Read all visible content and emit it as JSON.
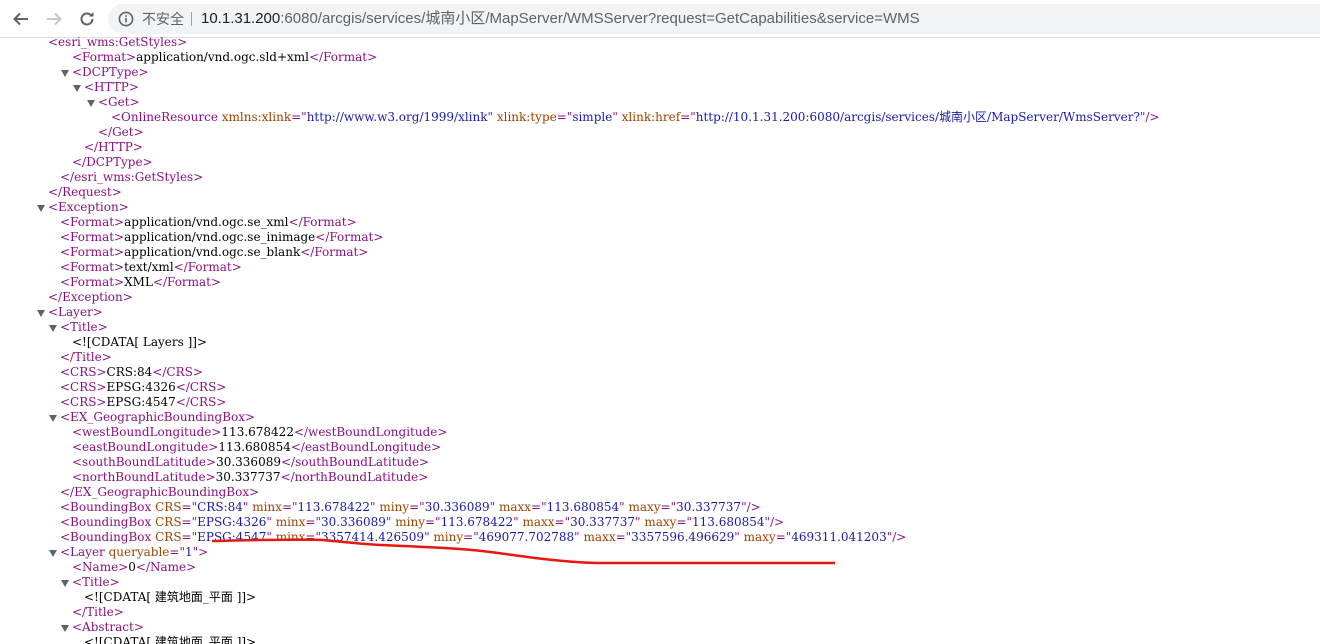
{
  "browser": {
    "security_label": "不安全",
    "url_host": "10.1.31.200",
    "url_rest": ":6080/arcgis/services/城南小区/MapServer/WMSServer?request=GetCapabilities&service=WMS"
  },
  "xml": {
    "lines": [
      {
        "indent": 48,
        "toggle": false,
        "segs": [
          {
            "c": "t",
            "v": "<esri_wms:GetStyles>"
          }
        ]
      },
      {
        "indent": 72,
        "toggle": false,
        "segs": [
          {
            "c": "t",
            "v": "<Format>"
          },
          {
            "c": "",
            "v": "application/vnd.ogc.sld+xml"
          },
          {
            "c": "t",
            "v": "</Format>"
          }
        ]
      },
      {
        "indent": 72,
        "toggle": true,
        "segs": [
          {
            "c": "t",
            "v": "<DCPType>"
          }
        ]
      },
      {
        "indent": 84,
        "toggle": true,
        "segs": [
          {
            "c": "t",
            "v": "<HTTP>"
          }
        ]
      },
      {
        "indent": 98,
        "toggle": true,
        "segs": [
          {
            "c": "t",
            "v": "<Get>"
          }
        ]
      },
      {
        "indent": 111,
        "toggle": false,
        "segs": [
          {
            "c": "t",
            "v": "<OnlineResource "
          },
          {
            "c": "an",
            "v": "xmlns:xlink"
          },
          {
            "c": "t",
            "v": "=\""
          },
          {
            "c": "av",
            "v": "http://www.w3.org/1999/xlink"
          },
          {
            "c": "t",
            "v": "\" "
          },
          {
            "c": "an",
            "v": "xlink:type"
          },
          {
            "c": "t",
            "v": "=\""
          },
          {
            "c": "av",
            "v": "simple"
          },
          {
            "c": "t",
            "v": "\" "
          },
          {
            "c": "an",
            "v": "xlink:href"
          },
          {
            "c": "t",
            "v": "=\""
          },
          {
            "c": "av",
            "v": "http://10.1.31.200:6080/arcgis/services/城南小区/MapServer/WmsServer?"
          },
          {
            "c": "t",
            "v": "\"/>"
          }
        ]
      },
      {
        "indent": 98,
        "toggle": false,
        "segs": [
          {
            "c": "t",
            "v": "</Get>"
          }
        ]
      },
      {
        "indent": 84,
        "toggle": false,
        "segs": [
          {
            "c": "t",
            "v": "</HTTP>"
          }
        ]
      },
      {
        "indent": 72,
        "toggle": false,
        "segs": [
          {
            "c": "t",
            "v": "</DCPType>"
          }
        ]
      },
      {
        "indent": 60,
        "toggle": false,
        "segs": [
          {
            "c": "t",
            "v": "</esri_wms:GetStyles>"
          }
        ]
      },
      {
        "indent": 48,
        "toggle": false,
        "segs": [
          {
            "c": "t",
            "v": "</Request>"
          }
        ]
      },
      {
        "indent": 48,
        "toggle": true,
        "segs": [
          {
            "c": "t",
            "v": "<Exception>"
          }
        ]
      },
      {
        "indent": 60,
        "toggle": false,
        "segs": [
          {
            "c": "t",
            "v": "<Format>"
          },
          {
            "c": "",
            "v": "application/vnd.ogc.se_xml"
          },
          {
            "c": "t",
            "v": "</Format>"
          }
        ]
      },
      {
        "indent": 60,
        "toggle": false,
        "segs": [
          {
            "c": "t",
            "v": "<Format>"
          },
          {
            "c": "",
            "v": "application/vnd.ogc.se_inimage"
          },
          {
            "c": "t",
            "v": "</Format>"
          }
        ]
      },
      {
        "indent": 60,
        "toggle": false,
        "segs": [
          {
            "c": "t",
            "v": "<Format>"
          },
          {
            "c": "",
            "v": "application/vnd.ogc.se_blank"
          },
          {
            "c": "t",
            "v": "</Format>"
          }
        ]
      },
      {
        "indent": 60,
        "toggle": false,
        "segs": [
          {
            "c": "t",
            "v": "<Format>"
          },
          {
            "c": "",
            "v": "text/xml"
          },
          {
            "c": "t",
            "v": "</Format>"
          }
        ]
      },
      {
        "indent": 60,
        "toggle": false,
        "segs": [
          {
            "c": "t",
            "v": "<Format>"
          },
          {
            "c": "",
            "v": "XML"
          },
          {
            "c": "t",
            "v": "</Format>"
          }
        ]
      },
      {
        "indent": 48,
        "toggle": false,
        "segs": [
          {
            "c": "t",
            "v": "</Exception>"
          }
        ]
      },
      {
        "indent": 48,
        "toggle": true,
        "segs": [
          {
            "c": "t",
            "v": "<Layer>"
          }
        ]
      },
      {
        "indent": 60,
        "toggle": true,
        "segs": [
          {
            "c": "t",
            "v": "<Title>"
          }
        ]
      },
      {
        "indent": 72,
        "toggle": false,
        "segs": [
          {
            "c": "",
            "v": "<![CDATA[ Layers ]]>"
          }
        ]
      },
      {
        "indent": 60,
        "toggle": false,
        "segs": [
          {
            "c": "t",
            "v": "</Title>"
          }
        ]
      },
      {
        "indent": 60,
        "toggle": false,
        "segs": [
          {
            "c": "t",
            "v": "<CRS>"
          },
          {
            "c": "",
            "v": "CRS:84"
          },
          {
            "c": "t",
            "v": "</CRS>"
          }
        ]
      },
      {
        "indent": 60,
        "toggle": false,
        "segs": [
          {
            "c": "t",
            "v": "<CRS>"
          },
          {
            "c": "",
            "v": "EPSG:4326"
          },
          {
            "c": "t",
            "v": "</CRS>"
          }
        ]
      },
      {
        "indent": 60,
        "toggle": false,
        "segs": [
          {
            "c": "t",
            "v": "<CRS>"
          },
          {
            "c": "",
            "v": "EPSG:4547"
          },
          {
            "c": "t",
            "v": "</CRS>"
          }
        ]
      },
      {
        "indent": 60,
        "toggle": true,
        "segs": [
          {
            "c": "t",
            "v": "<EX_GeographicBoundingBox>"
          }
        ]
      },
      {
        "indent": 72,
        "toggle": false,
        "segs": [
          {
            "c": "t",
            "v": "<westBoundLongitude>"
          },
          {
            "c": "",
            "v": "113.678422"
          },
          {
            "c": "t",
            "v": "</westBoundLongitude>"
          }
        ]
      },
      {
        "indent": 72,
        "toggle": false,
        "segs": [
          {
            "c": "t",
            "v": "<eastBoundLongitude>"
          },
          {
            "c": "",
            "v": "113.680854"
          },
          {
            "c": "t",
            "v": "</eastBoundLongitude>"
          }
        ]
      },
      {
        "indent": 72,
        "toggle": false,
        "segs": [
          {
            "c": "t",
            "v": "<southBoundLatitude>"
          },
          {
            "c": "",
            "v": "30.336089"
          },
          {
            "c": "t",
            "v": "</southBoundLatitude>"
          }
        ]
      },
      {
        "indent": 72,
        "toggle": false,
        "segs": [
          {
            "c": "t",
            "v": "<northBoundLatitude>"
          },
          {
            "c": "",
            "v": "30.337737"
          },
          {
            "c": "t",
            "v": "</northBoundLatitude>"
          }
        ]
      },
      {
        "indent": 60,
        "toggle": false,
        "segs": [
          {
            "c": "t",
            "v": "</EX_GeographicBoundingBox>"
          }
        ]
      },
      {
        "indent": 60,
        "toggle": false,
        "segs": [
          {
            "c": "t",
            "v": "<BoundingBox "
          },
          {
            "c": "an",
            "v": "CRS"
          },
          {
            "c": "t",
            "v": "=\""
          },
          {
            "c": "av",
            "v": "CRS:84"
          },
          {
            "c": "t",
            "v": "\" "
          },
          {
            "c": "an",
            "v": "minx"
          },
          {
            "c": "t",
            "v": "=\""
          },
          {
            "c": "av",
            "v": "113.678422"
          },
          {
            "c": "t",
            "v": "\" "
          },
          {
            "c": "an",
            "v": "miny"
          },
          {
            "c": "t",
            "v": "=\""
          },
          {
            "c": "av",
            "v": "30.336089"
          },
          {
            "c": "t",
            "v": "\" "
          },
          {
            "c": "an",
            "v": "maxx"
          },
          {
            "c": "t",
            "v": "=\""
          },
          {
            "c": "av",
            "v": "113.680854"
          },
          {
            "c": "t",
            "v": "\" "
          },
          {
            "c": "an",
            "v": "maxy"
          },
          {
            "c": "t",
            "v": "=\""
          },
          {
            "c": "av",
            "v": "30.337737"
          },
          {
            "c": "t",
            "v": "\"/>"
          }
        ]
      },
      {
        "indent": 60,
        "toggle": false,
        "segs": [
          {
            "c": "t",
            "v": "<BoundingBox "
          },
          {
            "c": "an",
            "v": "CRS"
          },
          {
            "c": "t",
            "v": "=\""
          },
          {
            "c": "av",
            "v": "EPSG:4326"
          },
          {
            "c": "t",
            "v": "\" "
          },
          {
            "c": "an",
            "v": "minx"
          },
          {
            "c": "t",
            "v": "=\""
          },
          {
            "c": "av",
            "v": "30.336089"
          },
          {
            "c": "t",
            "v": "\" "
          },
          {
            "c": "an",
            "v": "miny"
          },
          {
            "c": "t",
            "v": "=\""
          },
          {
            "c": "av",
            "v": "113.678422"
          },
          {
            "c": "t",
            "v": "\" "
          },
          {
            "c": "an",
            "v": "maxx"
          },
          {
            "c": "t",
            "v": "=\""
          },
          {
            "c": "av",
            "v": "30.337737"
          },
          {
            "c": "t",
            "v": "\" "
          },
          {
            "c": "an",
            "v": "maxy"
          },
          {
            "c": "t",
            "v": "=\""
          },
          {
            "c": "av",
            "v": "113.680854"
          },
          {
            "c": "t",
            "v": "\"/>"
          }
        ]
      },
      {
        "indent": 60,
        "toggle": false,
        "segs": [
          {
            "c": "t",
            "v": "<BoundingBox "
          },
          {
            "c": "an",
            "v": "CRS"
          },
          {
            "c": "t",
            "v": "=\""
          },
          {
            "c": "av",
            "v": "EPSG:4547"
          },
          {
            "c": "t",
            "v": "\" "
          },
          {
            "c": "an",
            "v": "minx"
          },
          {
            "c": "t",
            "v": "=\""
          },
          {
            "c": "av",
            "v": "3357414.426509"
          },
          {
            "c": "t",
            "v": "\" "
          },
          {
            "c": "an",
            "v": "miny"
          },
          {
            "c": "t",
            "v": "=\""
          },
          {
            "c": "av",
            "v": "469077.702788"
          },
          {
            "c": "t",
            "v": "\" "
          },
          {
            "c": "an",
            "v": "maxx"
          },
          {
            "c": "t",
            "v": "=\""
          },
          {
            "c": "av",
            "v": "3357596.496629"
          },
          {
            "c": "t",
            "v": "\" "
          },
          {
            "c": "an",
            "v": "maxy"
          },
          {
            "c": "t",
            "v": "=\""
          },
          {
            "c": "av",
            "v": "469311.041203"
          },
          {
            "c": "t",
            "v": "\"/>"
          }
        ]
      },
      {
        "indent": 60,
        "toggle": true,
        "segs": [
          {
            "c": "t",
            "v": "<Layer "
          },
          {
            "c": "an",
            "v": "queryable"
          },
          {
            "c": "t",
            "v": "=\""
          },
          {
            "c": "av",
            "v": "1"
          },
          {
            "c": "t",
            "v": "\">"
          }
        ]
      },
      {
        "indent": 72,
        "toggle": false,
        "segs": [
          {
            "c": "t",
            "v": "<Name>"
          },
          {
            "c": "",
            "v": "0"
          },
          {
            "c": "t",
            "v": "</Name>"
          }
        ]
      },
      {
        "indent": 72,
        "toggle": true,
        "segs": [
          {
            "c": "t",
            "v": "<Title>"
          }
        ]
      },
      {
        "indent": 84,
        "toggle": false,
        "segs": [
          {
            "c": "",
            "v": "<![CDATA[ 建筑地面_平面 ]]>"
          }
        ]
      },
      {
        "indent": 72,
        "toggle": false,
        "segs": [
          {
            "c": "t",
            "v": "</Title>"
          }
        ]
      },
      {
        "indent": 72,
        "toggle": true,
        "segs": [
          {
            "c": "t",
            "v": "<Abstract>"
          }
        ]
      },
      {
        "indent": 84,
        "toggle": false,
        "segs": [
          {
            "c": "",
            "v": "<![CDATA[ 建筑地面_平面 ]]>"
          }
        ]
      }
    ]
  },
  "colors": {
    "tag": "#881280",
    "attr_name": "#994500",
    "attr_value": "#1a1aa6",
    "annotation": "#e8170f"
  }
}
